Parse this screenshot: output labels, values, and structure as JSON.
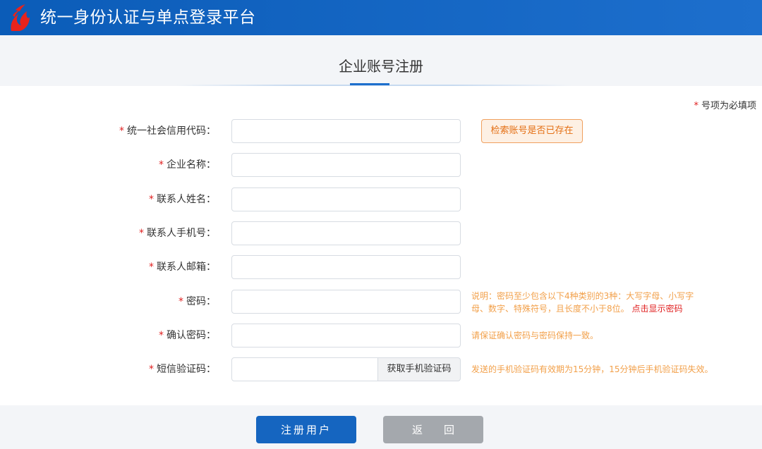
{
  "header": {
    "app_title": "统一身份认证与单点登录平台",
    "brand_color": "#1d6fcd",
    "logo_icon": "red-flame-logo-icon"
  },
  "page": {
    "title": "企业账号注册",
    "required_note": "号项为必填项",
    "required_marker": "*"
  },
  "form": {
    "fields": [
      {
        "label": "统一社会信用代码：",
        "value": "",
        "placeholder": ""
      },
      {
        "label": "企业名称：",
        "value": "",
        "placeholder": ""
      },
      {
        "label": "联系人姓名：",
        "value": "",
        "placeholder": ""
      },
      {
        "label": "联系人手机号：",
        "value": "",
        "placeholder": ""
      },
      {
        "label": "联系人邮箱：",
        "value": "",
        "placeholder": ""
      },
      {
        "label": "密码：",
        "value": "",
        "placeholder": ""
      },
      {
        "label": "确认密码：",
        "value": "",
        "placeholder": ""
      },
      {
        "label": "短信验证码：",
        "value": "",
        "placeholder": ""
      }
    ],
    "check_account_button": "检索账号是否已存在",
    "sms_button": "获取手机验证码",
    "password_hint_line1": "说明：密码至少包含以下4种类别的3种：大写字母、小写字",
    "password_hint_line2": "母、数字、特殊符号，且长度不小于8位。",
    "show_password_link": "点击显示密码",
    "confirm_hint": "请保证确认密码与密码保持一致。",
    "sms_hint": "发送的手机验证码有效期为15分钟，15分钟后手机验证码失效。"
  },
  "actions": {
    "register_button": "注册用户",
    "back_button": "返回"
  },
  "colors": {
    "required_star": "#e02020",
    "hint_text": "#f2a04a",
    "primary_button": "#1565c0",
    "secondary_button": "#a4a8ad"
  }
}
